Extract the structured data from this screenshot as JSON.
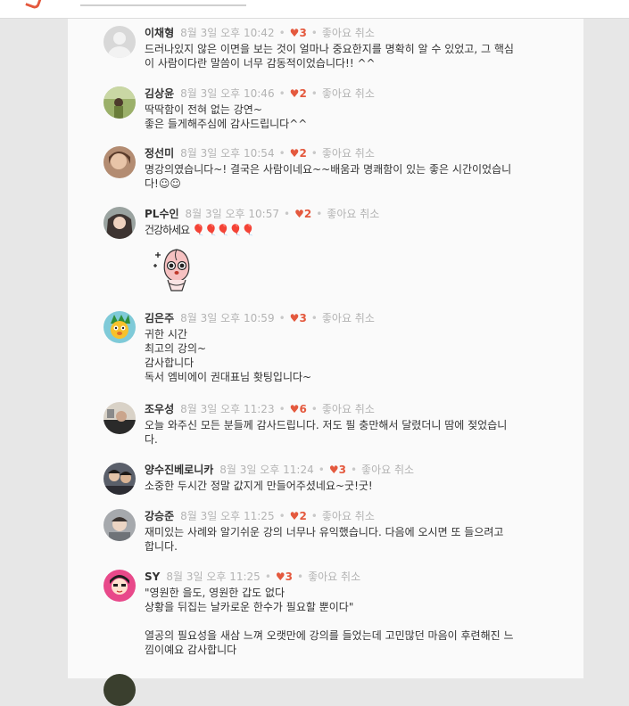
{
  "colors": {
    "accent": "#e4593e",
    "meta": "#b3b3b3",
    "text": "#333333"
  },
  "comments": [
    {
      "author": "이채형",
      "time": "8월 3일 오후 10:42",
      "likes": "3",
      "like_label": "좋아요 취소",
      "text": "드러나있지 않은 이면을 보는 것이 얼마나 중요한지를 명확히 알 수 있었고, 그 핵심\n이 사람이다란 말씀이 너무 감동적이었습니다!! ^^"
    },
    {
      "author": "김상윤",
      "time": "8월 3일 오후 10:46",
      "likes": "2",
      "like_label": "좋아요 취소",
      "text": "딱딱함이 전혀 없는 강연~\n좋은 들게해주심에 감사드립니다^^"
    },
    {
      "author": "정선미",
      "time": "8월 3일 오후 10:54",
      "likes": "2",
      "like_label": "좋아요 취소",
      "text": "명강의였습니다~! 결국은 사람이네요~~배움과 명쾌함이 있는 좋은 시간이었습니\n다!☺☺"
    },
    {
      "author": "PL수인",
      "time": "8월 3일 오후 10:57",
      "likes": "2",
      "like_label": "좋아요 취소",
      "text": "건강하세요 🎈🎈🎈🎈🎈"
    },
    {
      "author": "김은주",
      "time": "8월 3일 오후 10:59",
      "likes": "3",
      "like_label": "좋아요 취소",
      "text": "귀한 시간\n최고의 강의~\n감사합니다\n독서 엠비에이 권대표님 홧팅입니다~"
    },
    {
      "author": "조우성",
      "time": "8월 3일 오후 11:23",
      "likes": "6",
      "like_label": "좋아요 취소",
      "text": "오늘 와주신 모든 분들께 감사드립니다. 저도 필 충만해서 달렸더니 땀에 젖었습니\n다."
    },
    {
      "author": "양수진베로니카",
      "time": "8월 3일 오후 11:24",
      "likes": "3",
      "like_label": "좋아요 취소",
      "text": "소중한 두시간 정말 값지게 만들어주셨네요~굿!굿!"
    },
    {
      "author": "강승준",
      "time": "8월 3일 오후 11:25",
      "likes": "2",
      "like_label": "좋아요 취소",
      "text": "재미있는 사례와 알기쉬운 강의 너무나 유익했습니다. 다음에 오시면 또 들으려고\n합니다."
    },
    {
      "author": "SY",
      "time": "8월 3일 오후 11:25",
      "likes": "3",
      "like_label": "좋아요 취소",
      "text": "\"영원한 을도, 영원한 갑도 없다\n상황을 뒤집는 날카로운 한수가 필요할 뿐이다\"\n\n열공의 필요성을 새삼 느껴 오랫만에 강의를 들었는데 고민많던 마음이 후련해진 느\n낌이예요 감사합니다"
    }
  ]
}
